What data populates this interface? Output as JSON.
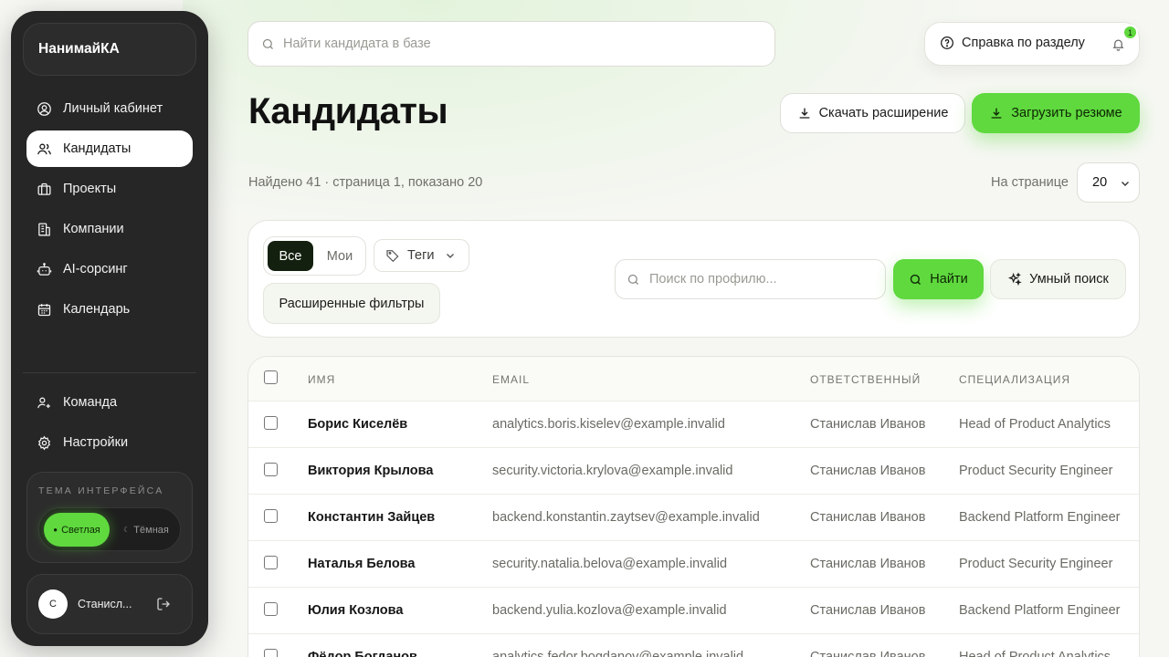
{
  "app": {
    "name": "НанимайКА"
  },
  "sidebar": {
    "nav": [
      {
        "label": "Личный кабинет",
        "icon": "user-circle-icon"
      },
      {
        "label": "Кандидаты",
        "icon": "users-icon",
        "active": true
      },
      {
        "label": "Проекты",
        "icon": "briefcase-icon"
      },
      {
        "label": "Компании",
        "icon": "building-icon"
      },
      {
        "label": "AI-сорсинг",
        "icon": "robot-icon"
      },
      {
        "label": "Календарь",
        "icon": "calendar-icon"
      }
    ],
    "nav2": [
      {
        "label": "Команда",
        "icon": "team-icon"
      },
      {
        "label": "Настройки",
        "icon": "gear-icon"
      }
    ],
    "theme": {
      "title": "Тема интерфейса",
      "light": "Светлая",
      "dark": "Тёмная",
      "selected": "light"
    },
    "user": {
      "initial": "С",
      "name": "Станисл..."
    }
  },
  "header": {
    "search_placeholder": "Найти кандидата в базе",
    "help": "Справка по разделу",
    "notifications": "1"
  },
  "page": {
    "title": "Кандидаты",
    "download_extension": "Скачать расширение",
    "upload_resume": "Загрузить резюме",
    "found": "Найдено 41 · страница 1, показано 20",
    "per_page_label": "На странице",
    "per_page": "20"
  },
  "filters": {
    "all": "Все",
    "mine": "Мои",
    "tags": "Теги",
    "advanced": "Расширенные фильтры",
    "profile_placeholder": "Поиск по профилю...",
    "find": "Найти",
    "smart": "Умный поиск"
  },
  "table": {
    "columns": [
      "Имя",
      "Email",
      "Ответственный",
      "Специализация"
    ],
    "rows": [
      {
        "name": "Борис Киселёв",
        "email": "analytics.boris.kiselev@example.invalid",
        "owner": "Станислав Иванов",
        "spec": "Head of Product Analytics"
      },
      {
        "name": "Виктория Крылова",
        "email": "security.victoria.krylova@example.invalid",
        "owner": "Станислав Иванов",
        "spec": "Product Security Engineer"
      },
      {
        "name": "Константин Зайцев",
        "email": "backend.konstantin.zaytsev@example.invalid",
        "owner": "Станислав Иванов",
        "spec": "Backend Platform Engineer"
      },
      {
        "name": "Наталья Белова",
        "email": "security.natalia.belova@example.invalid",
        "owner": "Станислав Иванов",
        "spec": "Product Security Engineer"
      },
      {
        "name": "Юлия Козлова",
        "email": "backend.yulia.kozlova@example.invalid",
        "owner": "Станислав Иванов",
        "spec": "Backend Platform Engineer"
      },
      {
        "name": "Фёдор Богданов",
        "email": "analytics.fedor.bogdanov@example.invalid",
        "owner": "Станислав Иванов",
        "spec": "Head of Product Analytics"
      }
    ]
  },
  "colors": {
    "accent": "#5fd93e",
    "sidebar": "#262626",
    "background": "#f6f7f3"
  }
}
